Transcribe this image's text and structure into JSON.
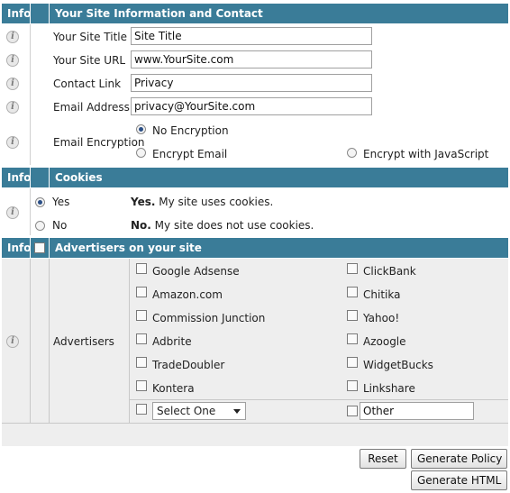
{
  "section1": {
    "info_label": "Info",
    "title": "Your Site Information and Contact",
    "fields": {
      "site_title": {
        "label": "Your Site Title",
        "value": "Site Title"
      },
      "site_url": {
        "label": "Your Site URL",
        "value": "www.YourSite.com"
      },
      "contact_link": {
        "label": "Contact Link",
        "value": "Privacy"
      },
      "email": {
        "label": "Email Address",
        "value": "privacy@YourSite.com"
      }
    },
    "encryption": {
      "label": "Email Encryption",
      "options": [
        "No Encryption",
        "Encrypt Email",
        "Encrypt with JavaScript"
      ],
      "selected": "No Encryption"
    }
  },
  "section2": {
    "info_label": "Info",
    "title": "Cookies",
    "yes": {
      "label": "Yes",
      "desc_bold": "Yes.",
      "desc": " My site uses cookies."
    },
    "no": {
      "label": "No",
      "desc_bold": "No.",
      "desc": " My site does not use cookies."
    },
    "selected": "Yes"
  },
  "section3": {
    "info_label": "Info",
    "title": "Advertisers on your site",
    "row_label": "Advertisers",
    "left": [
      "Google Adsense",
      "Amazon.com",
      "Commission Junction",
      "Adbrite",
      "TradeDoubler",
      "Kontera"
    ],
    "right": [
      "ClickBank",
      "Chitika",
      "Yahoo!",
      "Azoogle",
      "WidgetBucks",
      "Linkshare"
    ],
    "select_value": "Select One",
    "other_value": "Other"
  },
  "buttons": {
    "reset": "Reset",
    "generate_policy": "Generate Policy",
    "generate_html": "Generate HTML"
  }
}
